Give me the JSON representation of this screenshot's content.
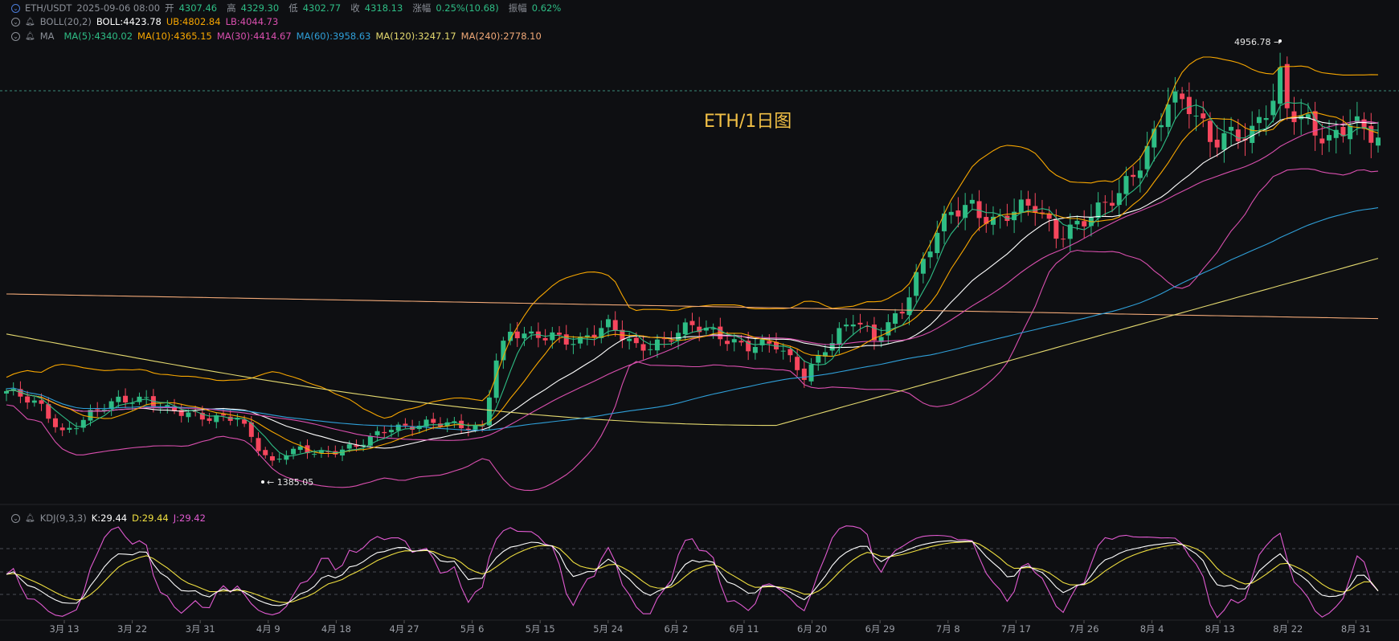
{
  "header": {
    "symbol": "ETH/USDT",
    "datetime": "2025-09-06 08:00",
    "open_label": "开",
    "open_value": "4307.46",
    "high_label": "高",
    "high_value": "4329.30",
    "low_label": "低",
    "low_value": "4302.77",
    "close_label": "收",
    "close_value": "4318.13",
    "change_label": "涨幅",
    "change_value": "0.25%(10.68)",
    "amp_label": "振幅",
    "amp_value": "0.62%"
  },
  "boll_legend": {
    "name": "BOLL(20,2)",
    "mid": "BOLL:4423.78",
    "ub": "UB:4802.84",
    "lb": "LB:4044.73"
  },
  "ma_legend": {
    "name": "MA",
    "items": [
      "MA(5):4340.02",
      "MA(10):4365.15",
      "MA(30):4414.67",
      "MA(60):3958.63",
      "MA(120):3247.17",
      "MA(240):2778.10"
    ]
  },
  "kdj_legend": {
    "name": "KDJ(9,3,3)",
    "k": "K:29.44",
    "d": "D:29.44",
    "j": "J:29.42"
  },
  "watermark": "ETH/1日图",
  "annotations": {
    "high_tag": "4956.78",
    "low_tag": "1385.05"
  },
  "colors": {
    "up": "#2ebd85",
    "down": "#f6465d",
    "ma5": "#2ebd85",
    "ma10": "#f7a600",
    "ma30": "#d94fae",
    "ma60": "#2f9fd8",
    "ma120": "#e4d96f",
    "ma240": "#f0a877",
    "boll_mid": "#ffffff",
    "boll_ub": "#f7a600",
    "boll_lb": "#d94fae",
    "k": "#ffffff",
    "d": "#f0e040",
    "j": "#e05ad0"
  },
  "chart_data": {
    "type": "candlestick",
    "x_tick_labels": [
      "3月 13",
      "3月 22",
      "3月 31",
      "4月 9",
      "4月 18",
      "4月 27",
      "5月 6",
      "5月 15",
      "5月 24",
      "6月 2",
      "6月 11",
      "6月 20",
      "6月 29",
      "7月 8",
      "7月 17",
      "7月 26",
      "8月 4",
      "8月 13",
      "8月 22",
      "8月 31"
    ],
    "y_range_approx": [
      1200,
      5100
    ],
    "close_path": [
      [
        0,
        2100
      ],
      [
        5,
        1950
      ],
      [
        8,
        1750
      ],
      [
        12,
        1900
      ],
      [
        16,
        2000
      ],
      [
        20,
        2050
      ],
      [
        24,
        1920
      ],
      [
        28,
        1850
      ],
      [
        33,
        1900
      ],
      [
        36,
        1600
      ],
      [
        38,
        1450
      ],
      [
        40,
        1550
      ],
      [
        42,
        1600
      ],
      [
        46,
        1570
      ],
      [
        50,
        1600
      ],
      [
        55,
        1800
      ],
      [
        60,
        1810
      ],
      [
        65,
        1790
      ],
      [
        68,
        1800
      ],
      [
        70,
        2400
      ],
      [
        72,
        2600
      ],
      [
        75,
        2550
      ],
      [
        78,
        2600
      ],
      [
        82,
        2550
      ],
      [
        86,
        2650
      ],
      [
        90,
        2500
      ],
      [
        94,
        2550
      ],
      [
        98,
        2650
      ],
      [
        102,
        2600
      ],
      [
        106,
        2500
      ],
      [
        110,
        2480
      ],
      [
        114,
        2250
      ],
      [
        117,
        2500
      ],
      [
        121,
        2700
      ],
      [
        124,
        2550
      ],
      [
        128,
        2850
      ],
      [
        132,
        3350
      ],
      [
        135,
        3650
      ],
      [
        138,
        3750
      ],
      [
        141,
        3600
      ],
      [
        144,
        3650
      ],
      [
        147,
        3700
      ],
      [
        150,
        3500
      ],
      [
        152,
        3550
      ],
      [
        156,
        3650
      ],
      [
        159,
        3800
      ],
      [
        163,
        4250
      ],
      [
        166,
        4650
      ],
      [
        169,
        4550
      ],
      [
        172,
        4300
      ],
      [
        175,
        4400
      ],
      [
        178,
        4350
      ],
      [
        181,
        4600
      ],
      [
        182,
        4800
      ],
      [
        183,
        4560
      ],
      [
        186,
        4500
      ],
      [
        189,
        4300
      ],
      [
        192,
        4400
      ],
      [
        194,
        4350
      ],
      [
        196,
        4318
      ]
    ],
    "extremes": {
      "high": 4956.78,
      "low": 1385.05
    },
    "series": [
      {
        "name": "MA(5)",
        "last": 4340.02
      },
      {
        "name": "MA(10)",
        "last": 4365.15
      },
      {
        "name": "MA(30)",
        "last": 4414.67
      },
      {
        "name": "MA(60)",
        "last": 3958.63
      },
      {
        "name": "MA(120)",
        "last": 3247.17
      },
      {
        "name": "MA(240)",
        "last": 2778.1
      },
      {
        "name": "BOLL",
        "last": 4423.78
      },
      {
        "name": "UB",
        "last": 4802.84
      },
      {
        "name": "LB",
        "last": 4044.73
      }
    ],
    "kdj": {
      "k_last": 29.44,
      "d_last": 29.44,
      "j_last": 29.42
    }
  }
}
